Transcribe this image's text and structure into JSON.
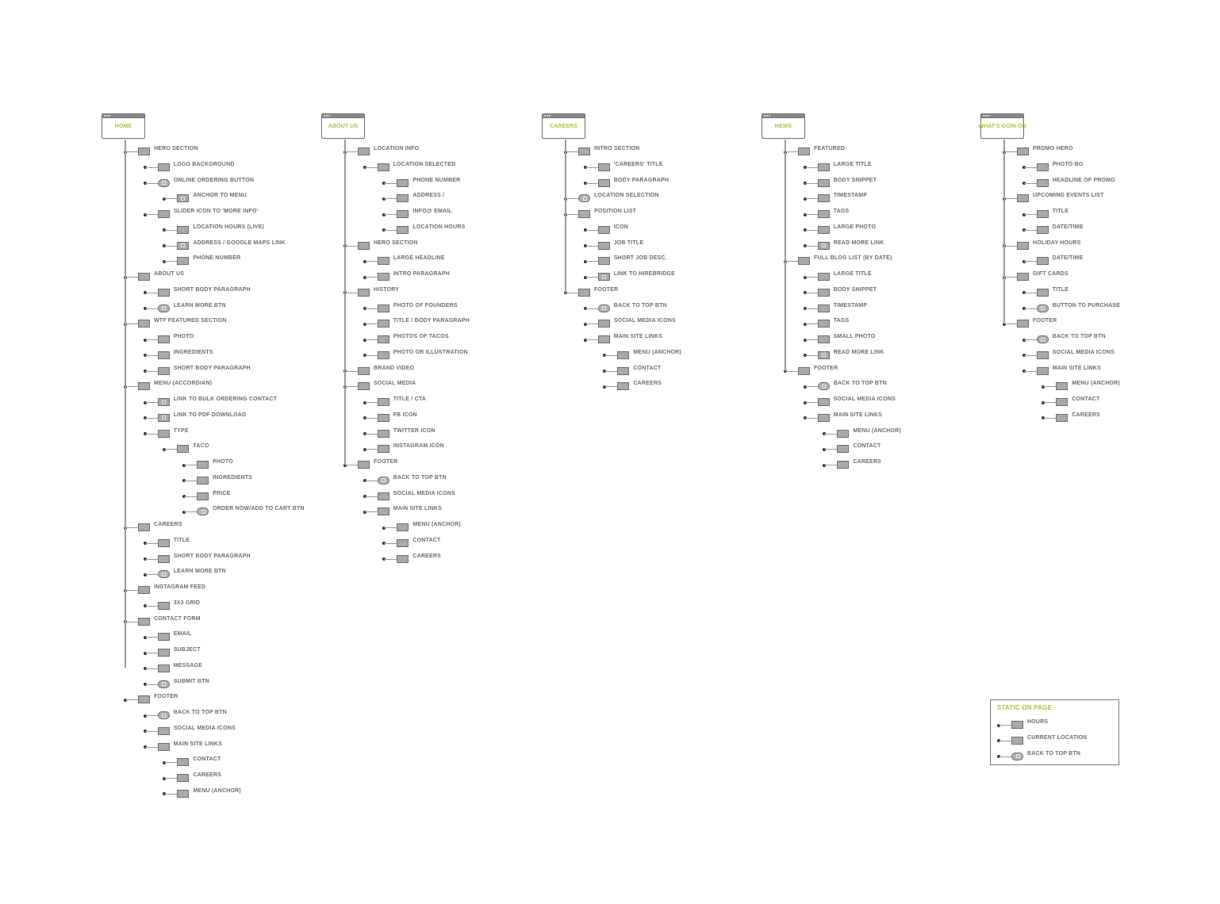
{
  "diagram": {
    "type": "sitemap",
    "colors": {
      "accent": "#a7c24a",
      "node_fill": "#a9a9a9",
      "node_border": "#6d6d6d",
      "label": "#6b6b6b",
      "connector": "#9a9a9a",
      "dot": "#333333"
    },
    "node_kinds": {
      "block": "placeholder-box",
      "link": "box-with-link-icon",
      "button": "rounded-button-with-link-icon"
    },
    "pages": [
      {
        "title": "HOME",
        "items": [
          {
            "label": "HERO SECTION",
            "level": 1,
            "kind": "block"
          },
          {
            "label": "LOGO BACKGROUND",
            "level": 2,
            "kind": "block"
          },
          {
            "label": "ONLINE ORDERING BUTTON",
            "level": 2,
            "kind": "button"
          },
          {
            "label": "ANCHOR TO MENU",
            "level": 3,
            "kind": "link"
          },
          {
            "label": "SLIDER ICON TO 'MORE INFO'",
            "level": 2,
            "kind": "block"
          },
          {
            "label": "LOCATION HOURS (LIVE)",
            "level": 3,
            "kind": "block"
          },
          {
            "label": "ADDRESS / GOOGLE MAPS LINK",
            "level": 3,
            "kind": "link"
          },
          {
            "label": "PHONE NUMBER",
            "level": 3,
            "kind": "block"
          },
          {
            "label": "ABOUT US",
            "level": 1,
            "kind": "block"
          },
          {
            "label": "SHORT BODY PARAGRAPH",
            "level": 2,
            "kind": "block"
          },
          {
            "label": "LEARN MORE BTN",
            "level": 2,
            "kind": "button"
          },
          {
            "label": "WTF FEATURED SECTION",
            "level": 1,
            "kind": "block"
          },
          {
            "label": "PHOTO",
            "level": 2,
            "kind": "block"
          },
          {
            "label": "INGREDIENTS",
            "level": 2,
            "kind": "block"
          },
          {
            "label": "SHORT BODY PARAGRAPH",
            "level": 2,
            "kind": "block"
          },
          {
            "label": "MENU (ACCORDIAN)",
            "level": 1,
            "kind": "block"
          },
          {
            "label": "LINK TO BULK ORDERING CONTACT",
            "level": 2,
            "kind": "link"
          },
          {
            "label": "LINK TO PDF DOWNLOAD",
            "level": 2,
            "kind": "link"
          },
          {
            "label": "TYPE",
            "level": 2,
            "kind": "block"
          },
          {
            "label": "TACO",
            "level": 3,
            "kind": "block"
          },
          {
            "label": "PHOTO",
            "level": 4,
            "kind": "block"
          },
          {
            "label": "INGREDIENTS",
            "level": 4,
            "kind": "block"
          },
          {
            "label": "PRICE",
            "level": 4,
            "kind": "block"
          },
          {
            "label": "ORDER NOW/ADD TO CART BTN",
            "level": 4,
            "kind": "button"
          },
          {
            "label": "CAREERS",
            "level": 1,
            "kind": "block"
          },
          {
            "label": "TITLE",
            "level": 2,
            "kind": "block"
          },
          {
            "label": "SHORT BODY PARAGRAPH",
            "level": 2,
            "kind": "block"
          },
          {
            "label": "LEARN MORE BTN",
            "level": 2,
            "kind": "button"
          },
          {
            "label": "INSTAGRAM FEED",
            "level": 1,
            "kind": "block"
          },
          {
            "label": "3X3 GRID",
            "level": 2,
            "kind": "block"
          },
          {
            "label": "CONTACT FORM",
            "level": 1,
            "kind": "block"
          },
          {
            "label": "EMAIL",
            "level": 2,
            "kind": "block"
          },
          {
            "label": "SUBJECT",
            "level": 2,
            "kind": "block"
          },
          {
            "label": "MESSAGE",
            "level": 2,
            "kind": "block"
          },
          {
            "label": "SUBMIT BTN",
            "level": 2,
            "kind": "button"
          },
          {
            "label": "FOOTER",
            "level": 1,
            "kind": "block"
          },
          {
            "label": "BACK TO TOP BTN",
            "level": 2,
            "kind": "button"
          },
          {
            "label": "SOCIAL MEDIA ICONS",
            "level": 2,
            "kind": "block"
          },
          {
            "label": "MAIN SITE LINKS",
            "level": 2,
            "kind": "block"
          },
          {
            "label": "CONTACT",
            "level": 3,
            "kind": "block"
          },
          {
            "label": "CAREERS",
            "level": 3,
            "kind": "block"
          },
          {
            "label": "MENU (ANCHOR)",
            "level": 3,
            "kind": "block"
          }
        ]
      },
      {
        "title": "ABOUT US",
        "items": [
          {
            "label": "LOCATION INFO",
            "level": 1,
            "kind": "block"
          },
          {
            "label": "LOCATION SELECTED",
            "level": 2,
            "kind": "block"
          },
          {
            "label": "PHONE NUMBER",
            "level": 3,
            "kind": "block"
          },
          {
            "label": "ADDRESS / GOOGLE MAPS LINK",
            "level": 3,
            "kind": "block",
            "clipped": true
          },
          {
            "label": "INFO@ EMAIL ADDRESS",
            "level": 3,
            "kind": "block",
            "clipped": true
          },
          {
            "label": "LOCATION HOURS (LIVE)",
            "level": 3,
            "kind": "block",
            "clipped": true
          },
          {
            "label": "HERO SECTION",
            "level": 1,
            "kind": "block"
          },
          {
            "label": "LARGE HEADLINE",
            "level": 2,
            "kind": "block"
          },
          {
            "label": "INTRO PARAGRAPH",
            "level": 2,
            "kind": "block"
          },
          {
            "label": "HISTORY",
            "level": 1,
            "kind": "block"
          },
          {
            "label": "PHOTO OF FOUNDERS",
            "level": 2,
            "kind": "block"
          },
          {
            "label": "TITLE / BODY PARAGRAPH",
            "level": 2,
            "kind": "block"
          },
          {
            "label": "PHOTOS OF TACOS",
            "level": 2,
            "kind": "block"
          },
          {
            "label": "PHOTO OR ILLUSTRATION",
            "level": 2,
            "kind": "block"
          },
          {
            "label": "BRAND VIDEO",
            "level": 1,
            "kind": "block"
          },
          {
            "label": "SOCIAL MEDIA",
            "level": 1,
            "kind": "block"
          },
          {
            "label": "TITLE / CTA",
            "level": 2,
            "kind": "block"
          },
          {
            "label": "FB ICON",
            "level": 2,
            "kind": "block"
          },
          {
            "label": "TWITTER ICON",
            "level": 2,
            "kind": "block"
          },
          {
            "label": "INSTAGRAM ICON",
            "level": 2,
            "kind": "block"
          },
          {
            "label": "FOOTER",
            "level": 1,
            "kind": "block"
          },
          {
            "label": "BACK TO TOP BTN",
            "level": 2,
            "kind": "button"
          },
          {
            "label": "SOCIAL MEDIA ICONS",
            "level": 2,
            "kind": "block"
          },
          {
            "label": "MAIN SITE LINKS",
            "level": 2,
            "kind": "block"
          },
          {
            "label": "MENU (ANCHOR)",
            "level": 3,
            "kind": "block"
          },
          {
            "label": "CONTACT",
            "level": 3,
            "kind": "block"
          },
          {
            "label": "CAREERS",
            "level": 3,
            "kind": "block"
          }
        ]
      },
      {
        "title": "CAREERS",
        "items": [
          {
            "label": "INTRO SECTION",
            "level": 1,
            "kind": "block"
          },
          {
            "label": "'CAREERS' TITLE",
            "level": 2,
            "kind": "block"
          },
          {
            "label": "BODY PARAGRAPH",
            "level": 2,
            "kind": "block"
          },
          {
            "label": "LOCATION SELECTION",
            "level": 1,
            "kind": "button"
          },
          {
            "label": "POSITION LIST",
            "level": 1,
            "kind": "block"
          },
          {
            "label": "ICON",
            "level": 2,
            "kind": "block"
          },
          {
            "label": "JOB TITLE",
            "level": 2,
            "kind": "block"
          },
          {
            "label": "SHORT JOB DESC.",
            "level": 2,
            "kind": "block"
          },
          {
            "label": "LINK TO HIREBRIDGE",
            "level": 2,
            "kind": "link"
          },
          {
            "label": "FOOTER",
            "level": 1,
            "kind": "block"
          },
          {
            "label": "BACK TO TOP BTN",
            "level": 2,
            "kind": "button"
          },
          {
            "label": "SOCIAL MEDIA ICONS",
            "level": 2,
            "kind": "block"
          },
          {
            "label": "MAIN SITE LINKS",
            "level": 2,
            "kind": "block"
          },
          {
            "label": "MENU (ANCHOR)",
            "level": 3,
            "kind": "block"
          },
          {
            "label": "CONTACT",
            "level": 3,
            "kind": "block"
          },
          {
            "label": "CAREERS",
            "level": 3,
            "kind": "block"
          }
        ]
      },
      {
        "title": "NEWS",
        "items": [
          {
            "label": "FEATURED",
            "level": 1,
            "kind": "block"
          },
          {
            "label": "LARGE TITLE",
            "level": 2,
            "kind": "block"
          },
          {
            "label": "BODY SNIPPET",
            "level": 2,
            "kind": "block"
          },
          {
            "label": "TIMESTAMP",
            "level": 2,
            "kind": "block"
          },
          {
            "label": "TAGS",
            "level": 2,
            "kind": "block"
          },
          {
            "label": "LARGE PHOTO",
            "level": 2,
            "kind": "block"
          },
          {
            "label": "READ MORE LINK",
            "level": 2,
            "kind": "link"
          },
          {
            "label": "FULL BLOG LIST (BY DATE)",
            "level": 1,
            "kind": "block"
          },
          {
            "label": "LARGE TITLE",
            "level": 2,
            "kind": "block"
          },
          {
            "label": "BODY SNIPPET",
            "level": 2,
            "kind": "block"
          },
          {
            "label": "TIMESTAMP",
            "level": 2,
            "kind": "block"
          },
          {
            "label": "TAGS",
            "level": 2,
            "kind": "block"
          },
          {
            "label": "SMALL PHOTO",
            "level": 2,
            "kind": "block"
          },
          {
            "label": "READ MORE LINK",
            "level": 2,
            "kind": "link"
          },
          {
            "label": "FOOTER",
            "level": 1,
            "kind": "block"
          },
          {
            "label": "BACK TO TOP BTN",
            "level": 2,
            "kind": "button"
          },
          {
            "label": "SOCIAL MEDIA ICONS",
            "level": 2,
            "kind": "block"
          },
          {
            "label": "MAIN SITE LINKS",
            "level": 2,
            "kind": "block"
          },
          {
            "label": "MENU (ANCHOR)",
            "level": 3,
            "kind": "block"
          },
          {
            "label": "CONTACT",
            "level": 3,
            "kind": "block"
          },
          {
            "label": "CAREERS",
            "level": 3,
            "kind": "block"
          }
        ]
      },
      {
        "title": "WHAT'S GOIN ON",
        "items": [
          {
            "label": "PROMO HERO",
            "level": 1,
            "kind": "block"
          },
          {
            "label": "PHOTO BG",
            "level": 2,
            "kind": "block"
          },
          {
            "label": "HEADLINE OF PROMO",
            "level": 2,
            "kind": "block"
          },
          {
            "label": "UPCOMING EVENTS LIST",
            "level": 1,
            "kind": "block"
          },
          {
            "label": "TITLE",
            "level": 2,
            "kind": "block"
          },
          {
            "label": "DATE/TIME",
            "level": 2,
            "kind": "block"
          },
          {
            "label": "HOLIDAY HOURS",
            "level": 1,
            "kind": "block"
          },
          {
            "label": "DATE/TIME",
            "level": 2,
            "kind": "block"
          },
          {
            "label": "GIFT CARDS",
            "level": 1,
            "kind": "block"
          },
          {
            "label": "TITLE",
            "level": 2,
            "kind": "block"
          },
          {
            "label": "BUTTON TO PURCHASE",
            "level": 2,
            "kind": "button"
          },
          {
            "label": "FOOTER",
            "level": 1,
            "kind": "block"
          },
          {
            "label": "BACK TO TOP BTN",
            "level": 2,
            "kind": "button"
          },
          {
            "label": "SOCIAL MEDIA ICONS",
            "level": 2,
            "kind": "block"
          },
          {
            "label": "MAIN SITE LINKS",
            "level": 2,
            "kind": "block"
          },
          {
            "label": "MENU (ANCHOR)",
            "level": 3,
            "kind": "block"
          },
          {
            "label": "CONTACT",
            "level": 3,
            "kind": "block"
          },
          {
            "label": "CAREERS",
            "level": 3,
            "kind": "block"
          }
        ]
      }
    ],
    "legend": {
      "title": "STATIC ON PAGE",
      "items": [
        {
          "label": "HOURS",
          "kind": "block"
        },
        {
          "label": "CURRENT LOCATION",
          "kind": "block"
        },
        {
          "label": "BACK TO TOP BTN",
          "kind": "button"
        }
      ]
    }
  }
}
